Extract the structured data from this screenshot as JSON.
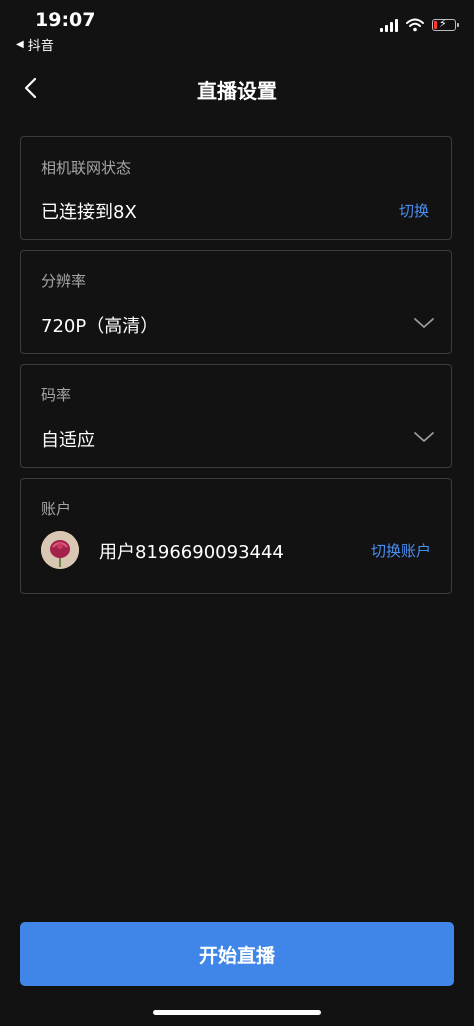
{
  "status_bar": {
    "time": "19:07",
    "back_app": "抖音"
  },
  "header": {
    "title": "直播设置"
  },
  "network": {
    "label": "相机联网状态",
    "value": "已连接到8X",
    "action": "切换"
  },
  "resolution": {
    "label": "分辨率",
    "value": "720P（高清）"
  },
  "bitrate": {
    "label": "码率",
    "value": "自适应"
  },
  "account": {
    "label": "账户",
    "username": "用户8196690093444",
    "action": "切换账户"
  },
  "start_button": {
    "label": "开始直播"
  },
  "colors": {
    "accent": "#3f86e8",
    "link": "#4a8ef0",
    "background": "#121212",
    "border": "#3c3c3c"
  }
}
